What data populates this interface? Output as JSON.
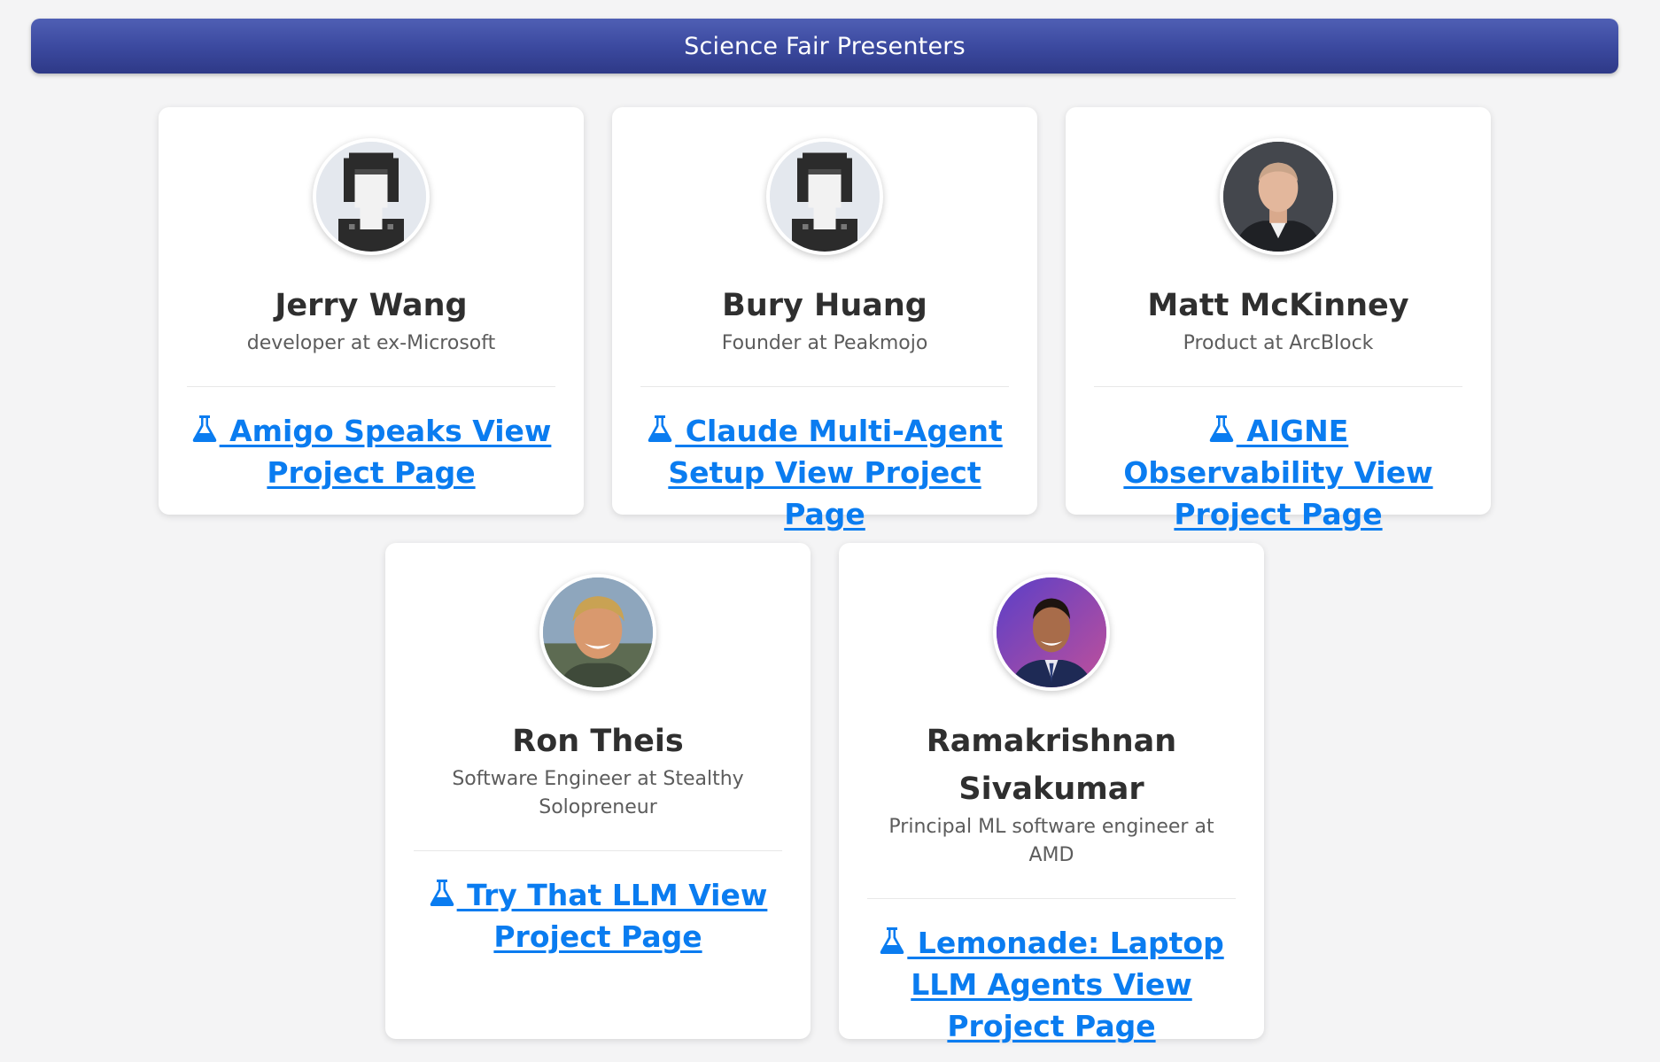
{
  "header": {
    "title": "Science Fair Presenters"
  },
  "colors": {
    "banner": "#3c4aa0",
    "link": "#0a7cf0",
    "background": "#f4f4f5"
  },
  "presenters": [
    {
      "name": "Jerry Wang",
      "role": "developer at ex-Microsoft",
      "project_icon": "flask-icon",
      "project": " Amigo Speaks View Project Page",
      "avatar": "pixel-avatar"
    },
    {
      "name": "Bury Huang",
      "role": "Founder at Peakmojo",
      "project_icon": "flask-icon",
      "project": " Claude Multi-Agent Setup View Project Page",
      "avatar": "pixel-avatar"
    },
    {
      "name": "Matt McKinney",
      "role": "Product at ArcBlock",
      "project_icon": "flask-icon",
      "project": " AIGNE Observability View Project Page",
      "avatar": "photo-avatar"
    },
    {
      "name": "Ron Theis",
      "role": "Software Engineer at Stealthy Solopreneur",
      "project_icon": "flask-icon",
      "project": " Try That LLM View Project Page",
      "avatar": "photo-avatar"
    },
    {
      "name": "Ramakrishnan Sivakumar",
      "role": "Principal ML software engineer at AMD",
      "project_icon": "flask-icon",
      "project": " Lemonade: Laptop LLM Agents View Project Page",
      "avatar": "photo-avatar"
    }
  ]
}
